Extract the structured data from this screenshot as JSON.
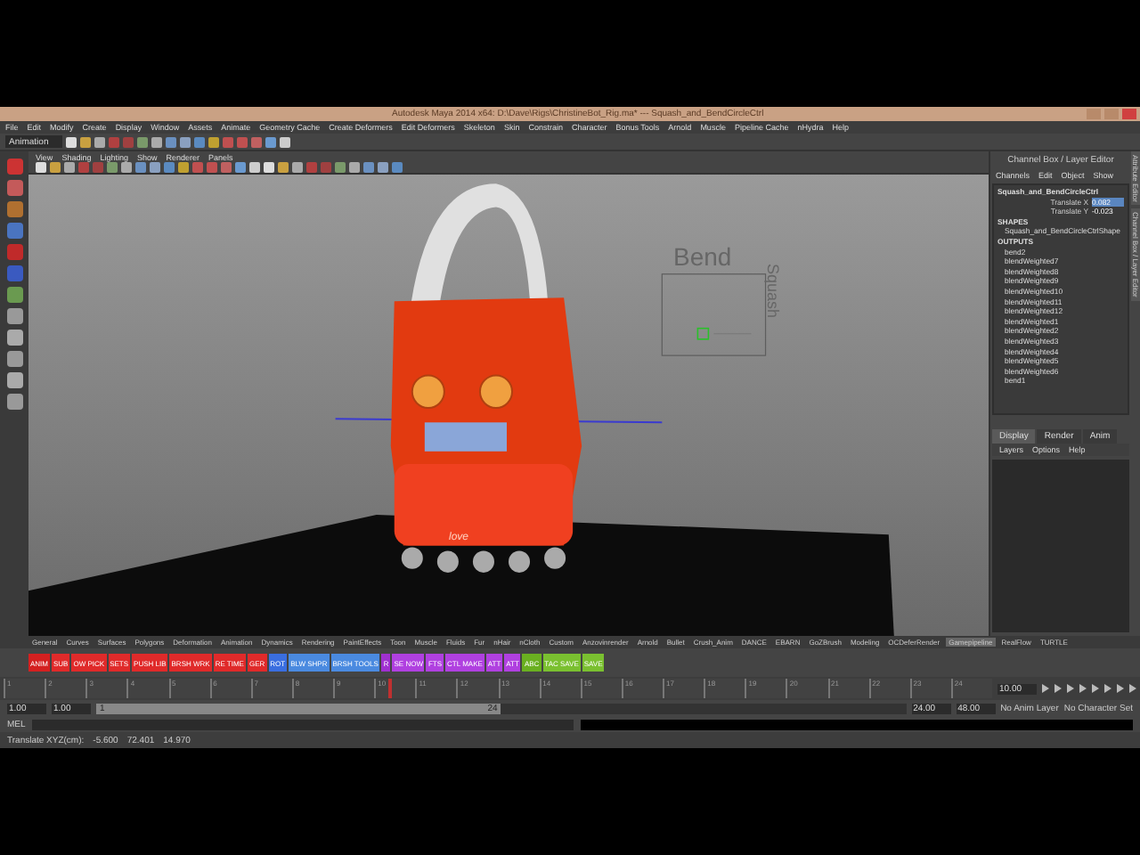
{
  "window": {
    "title": "Autodesk Maya 2014 x64: D:\\Dave\\Rigs\\ChristineBot_Rig.ma* --- Squash_and_BendCircleCtrl"
  },
  "menu": [
    "File",
    "Edit",
    "Modify",
    "Create",
    "Display",
    "Window",
    "Assets",
    "Animate",
    "Geometry Cache",
    "Create Deformers",
    "Edit Deformers",
    "Skeleton",
    "Skin",
    "Constrain",
    "Character",
    "Bonus Tools",
    "Arnold",
    "Muscle",
    "Pipeline Cache",
    "nHydra",
    "Help"
  ],
  "mode_menu": {
    "value": "Animation"
  },
  "panel_menu": [
    "View",
    "Shading",
    "Lighting",
    "Show",
    "Renderer",
    "Panels"
  ],
  "viewport": {
    "labels": [
      {
        "kind": "horizontal",
        "text": "Bend"
      },
      {
        "kind": "vertical",
        "text": "Squash"
      }
    ],
    "model_text": "love"
  },
  "channel_box": {
    "title": "Channel Box / Layer Editor",
    "menu": [
      "Channels",
      "Edit",
      "Object",
      "Show"
    ],
    "object": "Squash_and_BendCircleCtrl",
    "attributes": [
      {
        "name": "Translate X",
        "value": "0.082",
        "selected": true
      },
      {
        "name": "Translate Y",
        "value": "-0.023",
        "selected": false
      }
    ],
    "sections": [
      {
        "title": "SHAPES",
        "items": [
          "Squash_and_BendCircleCtrlShape"
        ]
      },
      {
        "title": "OUTPUTS",
        "items": [
          "bend2",
          "blendWeighted7",
          "blendWeighted8",
          "blendWeighted9",
          "blendWeighted10",
          "blendWeighted11",
          "blendWeighted12",
          "blendWeighted1",
          "blendWeighted2",
          "blendWeighted3",
          "blendWeighted4",
          "blendWeighted5",
          "blendWeighted6",
          "bend1"
        ]
      }
    ]
  },
  "layer_editor": {
    "tabs": [
      {
        "label": "Display",
        "selected": true
      },
      {
        "label": "Render",
        "selected": false
      },
      {
        "label": "Anim",
        "selected": false
      }
    ],
    "menu": [
      "Layers",
      "Options",
      "Help"
    ]
  },
  "side_tabs": [
    "Attribute Editor",
    "Channel Box / Layer Editor"
  ],
  "shelf_tabs": [
    {
      "label": "General",
      "selected": false
    },
    {
      "label": "Curves",
      "selected": false
    },
    {
      "label": "Surfaces",
      "selected": false
    },
    {
      "label": "Polygons",
      "selected": false
    },
    {
      "label": "Deformation",
      "selected": false
    },
    {
      "label": "Animation",
      "selected": false
    },
    {
      "label": "Dynamics",
      "selected": false
    },
    {
      "label": "Rendering",
      "selected": false
    },
    {
      "label": "PaintEffects",
      "selected": false
    },
    {
      "label": "Toon",
      "selected": false
    },
    {
      "label": "Muscle",
      "selected": false
    },
    {
      "label": "Fluids",
      "selected": false
    },
    {
      "label": "Fur",
      "selected": false
    },
    {
      "label": "nHair",
      "selected": false
    },
    {
      "label": "nCloth",
      "selected": false
    },
    {
      "label": "Custom",
      "selected": false
    },
    {
      "label": "Anzovinrender",
      "selected": false
    },
    {
      "label": "Arnold",
      "selected": false
    },
    {
      "label": "Bullet",
      "selected": false
    },
    {
      "label": "Crush_Anim",
      "selected": false
    },
    {
      "label": "DANCE",
      "selected": false
    },
    {
      "label": "EBARN",
      "selected": false
    },
    {
      "label": "GoZBrush",
      "selected": false
    },
    {
      "label": "Modeling",
      "selected": false
    },
    {
      "label": "OCDeferRender",
      "selected": false
    },
    {
      "label": "Gamepipeline",
      "selected": true
    },
    {
      "label": "RealFlow",
      "selected": false
    },
    {
      "label": "TURTLE",
      "selected": false
    }
  ],
  "shelf_buttons": [
    {
      "label": "ANIM",
      "color": "#d42020"
    },
    {
      "label": "SUB",
      "color": "#e02a2a"
    },
    {
      "label": "OW PICK",
      "color": "#e02a2a"
    },
    {
      "label": "SETS",
      "color": "#e02a2a"
    },
    {
      "label": "PUSH LIB",
      "color": "#e02a2a"
    },
    {
      "label": "BRSH WRK",
      "color": "#e02a2a"
    },
    {
      "label": "RE TIME",
      "color": "#e02a2a"
    },
    {
      "label": "GER",
      "color": "#e02a2a"
    },
    {
      "label": "ROT",
      "color": "#3a6ee0"
    },
    {
      "label": "BLW SHPR",
      "color": "#4a8ae0"
    },
    {
      "label": "BRSH TOOLS",
      "color": "#4a8ae0"
    },
    {
      "label": "R",
      "color": "#a030d0"
    },
    {
      "label": "SE NOW",
      "color": "#b040e0"
    },
    {
      "label": "FTS",
      "color": "#b040e0"
    },
    {
      "label": "CTL MAKE",
      "color": "#b040e0"
    },
    {
      "label": "ATT",
      "color": "#b040e0"
    },
    {
      "label": "ATT",
      "color": "#b040e0"
    },
    {
      "label": "ABC",
      "color": "#6ab020"
    },
    {
      "label": "TAC SAVE",
      "color": "#7ac030"
    },
    {
      "label": "SAVE",
      "color": "#7ac030"
    }
  ],
  "timeline": {
    "ticks": [
      "1",
      "2",
      "3",
      "4",
      "5",
      "6",
      "7",
      "8",
      "9",
      "10",
      "11",
      "12",
      "13",
      "14",
      "15",
      "16",
      "17",
      "18",
      "19",
      "20",
      "21",
      "22",
      "23",
      "24"
    ],
    "current_frame": "10.00",
    "level": 0.39
  },
  "range": {
    "level": 0.5,
    "start": "1.00",
    "playback_start": "1.00",
    "slider_start": "1",
    "slider_end": "24",
    "playback_end": "24.00",
    "end": "48.00",
    "anim_layer": "No Anim Layer",
    "character_set": "No Character Set"
  },
  "command_line": {
    "label": "MEL"
  },
  "help_line": [
    "Translate XYZ(cm):",
    "-5.600",
    "72.401",
    "14.970"
  ]
}
